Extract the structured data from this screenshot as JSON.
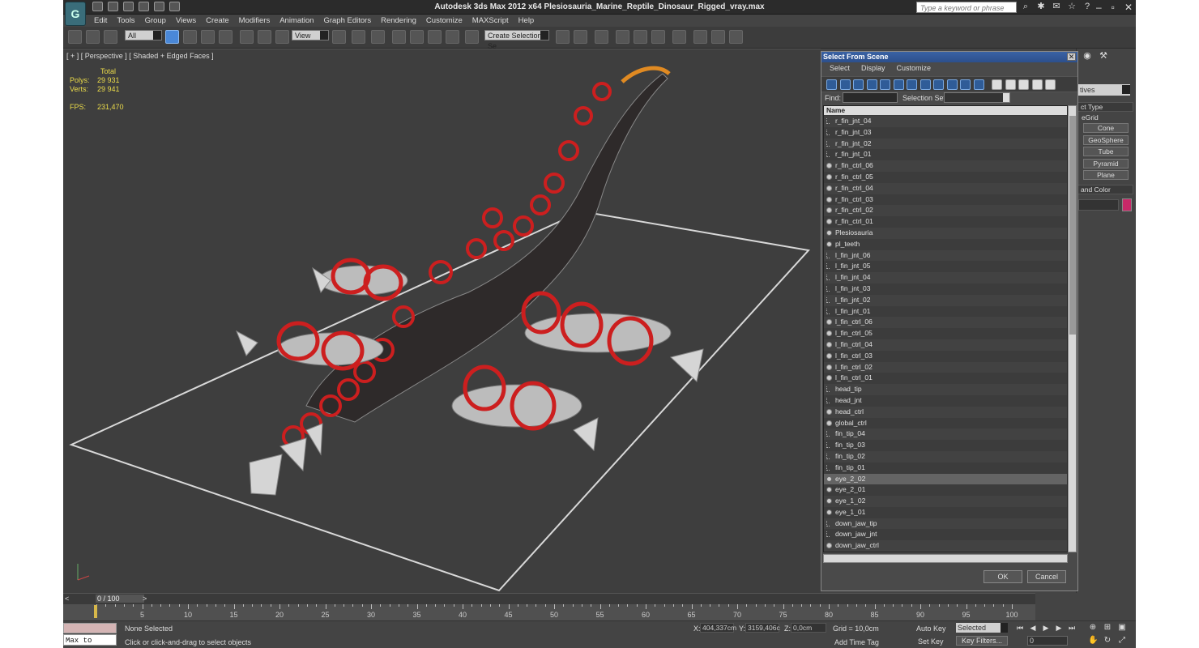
{
  "title": "Autodesk 3ds Max  2012 x64    Plesiosauria_Marine_Reptile_Dinosaur_Rigged_vray.max",
  "search_placeholder": "Type a keyword or phrase",
  "menu": [
    "Edit",
    "Tools",
    "Group",
    "Views",
    "Create",
    "Modifiers",
    "Animation",
    "Graph Editors",
    "Rendering",
    "Customize",
    "MAXScript",
    "Help"
  ],
  "toolbar": {
    "filter": "All",
    "refcoord": "View",
    "named_sel": "Create Selection Se"
  },
  "viewport": {
    "label": "[ + ] [ Perspective ] [ Shaded + Edged Faces ]",
    "stats": {
      "total": "Total",
      "polys_label": "Polys:",
      "polys": "29 931",
      "verts_label": "Verts:",
      "verts": "29 941",
      "fps_label": "FPS:",
      "fps": "231,470"
    }
  },
  "dialog": {
    "title": "Select From Scene",
    "menu": [
      "Select",
      "Display",
      "Customize"
    ],
    "find_label": "Find:",
    "selset_label": "Selection Set:",
    "column": "Name",
    "items": [
      {
        "name": "r_fin_jnt_04",
        "type": "j"
      },
      {
        "name": "r_fin_jnt_03",
        "type": "j"
      },
      {
        "name": "r_fin_jnt_02",
        "type": "j"
      },
      {
        "name": "r_fin_jnt_01",
        "type": "j"
      },
      {
        "name": "r_fin_ctrl_06",
        "type": "c"
      },
      {
        "name": "r_fin_ctrl_05",
        "type": "c"
      },
      {
        "name": "r_fin_ctrl_04",
        "type": "c"
      },
      {
        "name": "r_fin_ctrl_03",
        "type": "c"
      },
      {
        "name": "r_fin_ctrl_02",
        "type": "c"
      },
      {
        "name": "r_fin_ctrl_01",
        "type": "c"
      },
      {
        "name": "Plesiosauria",
        "type": "g"
      },
      {
        "name": "pl_teeth",
        "type": "g"
      },
      {
        "name": "l_fin_jnt_06",
        "type": "j"
      },
      {
        "name": "l_fin_jnt_05",
        "type": "j"
      },
      {
        "name": "l_fin_jnt_04",
        "type": "j"
      },
      {
        "name": "l_fin_jnt_03",
        "type": "j"
      },
      {
        "name": "l_fin_jnt_02",
        "type": "j"
      },
      {
        "name": "l_fin_jnt_01",
        "type": "j"
      },
      {
        "name": "l_fin_ctrl_06",
        "type": "c"
      },
      {
        "name": "l_fin_ctrl_05",
        "type": "c"
      },
      {
        "name": "l_fin_ctrl_04",
        "type": "c"
      },
      {
        "name": "l_fin_ctrl_03",
        "type": "c"
      },
      {
        "name": "l_fin_ctrl_02",
        "type": "c"
      },
      {
        "name": "l_fin_ctrl_01",
        "type": "c"
      },
      {
        "name": "head_tip",
        "type": "j"
      },
      {
        "name": "head_jnt",
        "type": "j"
      },
      {
        "name": "head_ctrl",
        "type": "c"
      },
      {
        "name": "global_ctrl",
        "type": "c"
      },
      {
        "name": "fin_tip_04",
        "type": "j"
      },
      {
        "name": "fin_tip_03",
        "type": "j"
      },
      {
        "name": "fin_tip_02",
        "type": "j"
      },
      {
        "name": "fin_tip_01",
        "type": "j"
      },
      {
        "name": "eye_2_02",
        "type": "g",
        "selected": true
      },
      {
        "name": "eye_2_01",
        "type": "g"
      },
      {
        "name": "eye_1_02",
        "type": "g"
      },
      {
        "name": "eye_1_01",
        "type": "g"
      },
      {
        "name": "down_jaw_tip",
        "type": "j"
      },
      {
        "name": "down_jaw_jnt",
        "type": "j"
      },
      {
        "name": "down_jaw_ctrl",
        "type": "c"
      }
    ],
    "ok": "OK",
    "cancel": "Cancel"
  },
  "cmdpanel": {
    "dropdown": "tives",
    "rollout_objtype": "ct Type",
    "autogrid": "eGrid",
    "buttons": [
      "Cone",
      "GeoSphere",
      "Tube",
      "Pyramid",
      "Plane"
    ],
    "rollout_color": "and Color",
    "swatch_color": "#c82868"
  },
  "timeline": {
    "frame": "0 / 100",
    "ticks": [
      "5",
      "10",
      "15",
      "20",
      "25",
      "30",
      "35",
      "40",
      "45",
      "50",
      "55",
      "60",
      "65",
      "70",
      "75",
      "80",
      "85",
      "90",
      "95",
      "100"
    ]
  },
  "status": {
    "maxscript": "Max to Physc",
    "selected": "None Selected",
    "prompt": "Click or click-and-drag to select objects",
    "x_label": "X:",
    "x": "404,337cm",
    "y_label": "Y:",
    "y": "3159,406c",
    "z_label": "Z:",
    "z": "0,0cm",
    "grid": "Grid = 10,0cm",
    "add_time_tag": "Add Time Tag",
    "auto_key": "Auto Key",
    "set_key": "Set Key",
    "key_mode": "Selected",
    "key_filters": "Key Filters...",
    "frame": "0"
  }
}
